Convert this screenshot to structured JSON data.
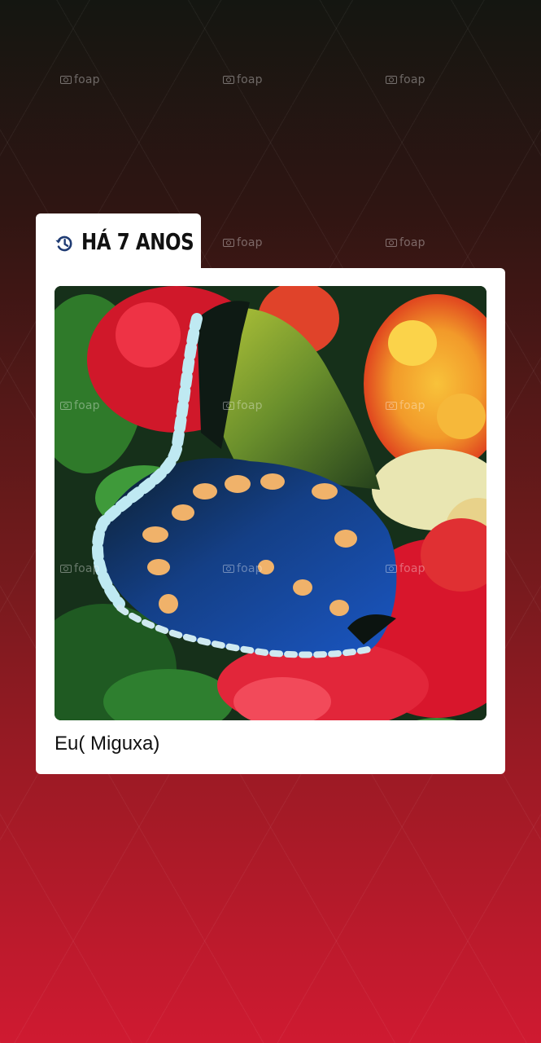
{
  "memory": {
    "time_label": "HÁ 7 ANOS",
    "caption": "Eu( Miguxa)"
  },
  "photo": {
    "subject": "butterfly on red and orange flowers"
  },
  "watermark": {
    "text": "foap"
  },
  "icons": {
    "history": "history-clock-icon",
    "watermark": "camera-icon"
  },
  "colors": {
    "background_top": "#141611",
    "background_bottom": "#cf1a31",
    "card": "#ffffff",
    "text": "#111111"
  }
}
